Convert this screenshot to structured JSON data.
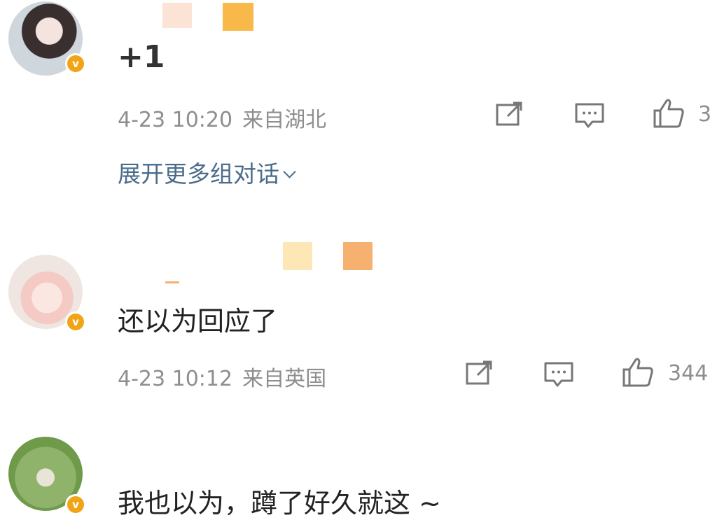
{
  "comments": [
    {
      "text": "+1",
      "date": "4-23 10:20",
      "location": "来自湖北",
      "likes": "3",
      "name_colors": [
        "#fbe4d6",
        "#f8b84a"
      ]
    },
    {
      "text": "还以为回应了",
      "date": "4-23 10:12",
      "location": "来自英国",
      "likes": "344",
      "name_colors": [
        "#fde7b6",
        "#f6b171"
      ]
    },
    {
      "text": "我也以为，蹲了好久就这 ~"
    }
  ],
  "expand_label": "展开更多组对话",
  "verify_badge": "v",
  "colors": {
    "meta_gray": "#8e8e8e",
    "link_blue": "#4a6b8a",
    "badge_orange": "#f1a416"
  }
}
